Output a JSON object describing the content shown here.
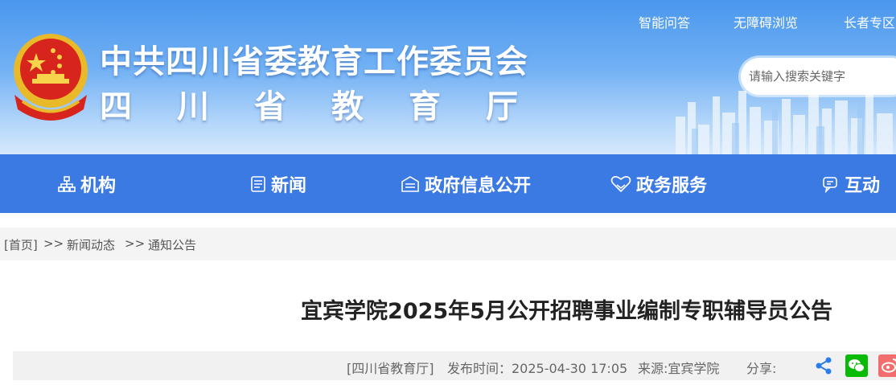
{
  "header": {
    "title_line1": "中共四川省委教育工作委员会",
    "title_line2": "四川省教育厅",
    "top_links": [
      "智能问答",
      "无障碍浏览",
      "长者专区"
    ],
    "search_placeholder": "请输入搜索关键字",
    "emblem_icon": "national-emblem-icon"
  },
  "nav": {
    "items": [
      {
        "label": "机构",
        "icon": "org-chart-icon"
      },
      {
        "label": "新闻",
        "icon": "news-icon"
      },
      {
        "label": "政府信息公开",
        "icon": "info-disclosure-icon"
      },
      {
        "label": "政务服务",
        "icon": "service-heart-icon"
      },
      {
        "label": "互动",
        "icon": "chat-icon"
      }
    ]
  },
  "breadcrumb": {
    "home": "[首页]",
    "sep": ">>",
    "level1": "新闻动态",
    "level2": "通知公告"
  },
  "article": {
    "title": "宜宾学院2025年5月公开招聘事业编制专职辅导员公告",
    "publisher": "[四川省教育厅]",
    "publish_time": "发布时间：2025-04-30 17:05",
    "source": "来源:宜宾学院",
    "share_label": "分享:",
    "share_icons": [
      "share-icon",
      "wechat-icon",
      "weibo-icon"
    ]
  },
  "colors": {
    "nav_bg": "#3b79e3",
    "header_top": "#4a97ee",
    "wechat": "#09bb07",
    "weibo": "#f26d6d",
    "share": "#2b7de9"
  }
}
